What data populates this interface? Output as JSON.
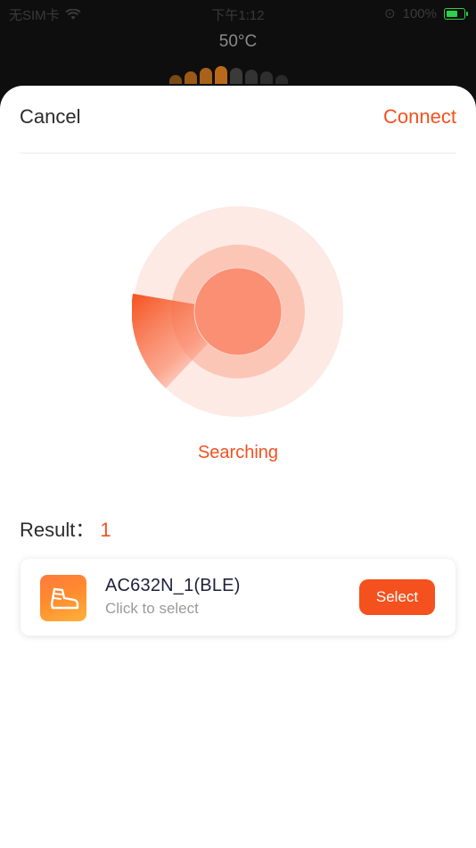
{
  "status_bar": {
    "carrier": "无SIM卡",
    "time": "下午1:12",
    "battery_percent": "100%"
  },
  "background_app": {
    "temperature": "50°C"
  },
  "sheet": {
    "cancel_label": "Cancel",
    "connect_label": "Connect",
    "searching_label": "Searching",
    "result_label": "Result：",
    "result_count": "1",
    "devices": [
      {
        "name": "AC632N_1(BLE)",
        "subtitle": "Click to select",
        "select_label": "Select",
        "icon": "shoe-icon"
      }
    ]
  },
  "colors": {
    "accent": "#f4511e",
    "radar_outer": "#fdeae5",
    "radar_mid": "#fcc6b7",
    "radar_inner": "#fa8f73"
  }
}
